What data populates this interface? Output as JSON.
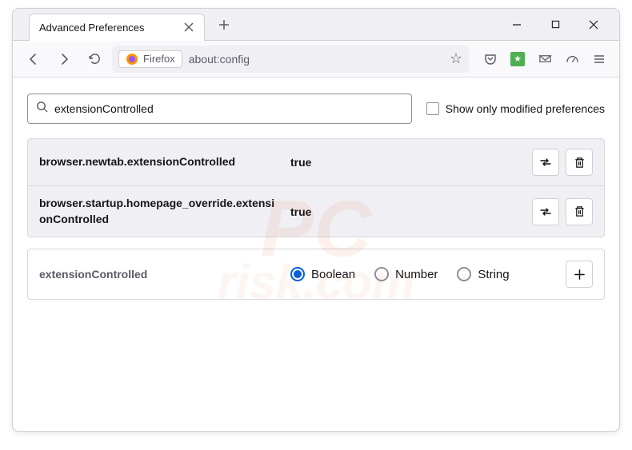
{
  "tab": {
    "title": "Advanced Preferences"
  },
  "urlbar": {
    "identity": "Firefox",
    "url": "about:config"
  },
  "search": {
    "value": "extensionControlled",
    "checkbox_label": "Show only modified preferences"
  },
  "prefs": [
    {
      "name": "browser.newtab.extensionControlled",
      "value": "true"
    },
    {
      "name": "browser.startup.homepage_override.extensionControlled",
      "value": "true"
    }
  ],
  "new_pref": {
    "name": "extensionControlled",
    "types": [
      "Boolean",
      "Number",
      "String"
    ],
    "selected": 0
  },
  "watermark": {
    "line1": "PC",
    "line2": "risk.com"
  }
}
